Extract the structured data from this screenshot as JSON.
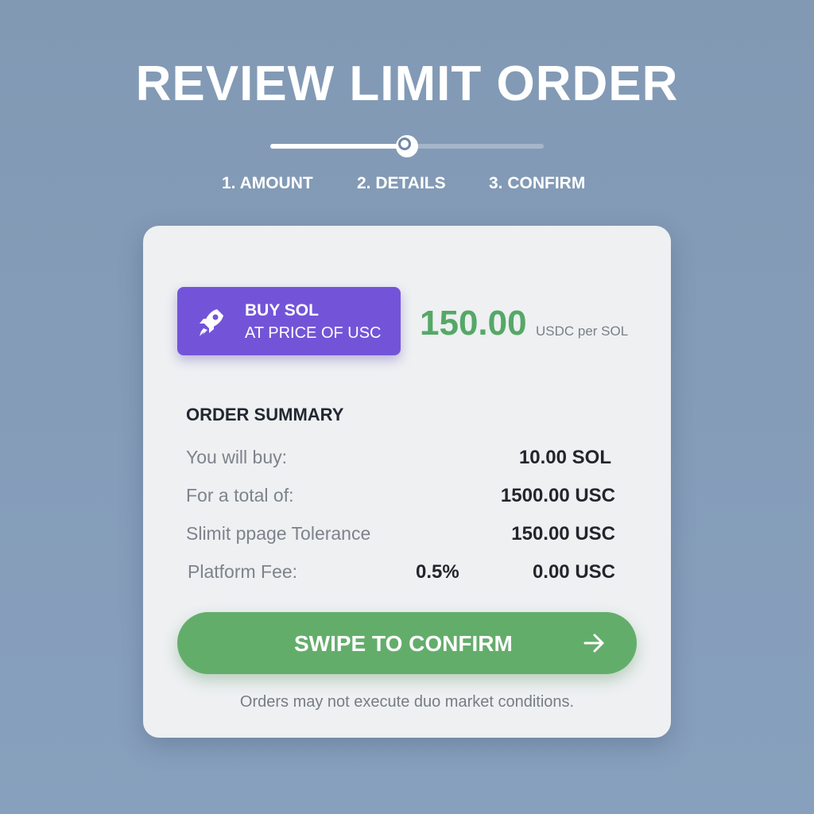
{
  "header": {
    "title": "REVIEW LIMIT ORDER",
    "progress_fraction": 0.5,
    "steps": [
      {
        "label": "1. AMOUNT"
      },
      {
        "label": "2. DETAILS"
      },
      {
        "label": "3. CONFIRM"
      }
    ]
  },
  "order": {
    "badge_line1": "BUY SOL",
    "badge_line2": "AT PRICE OF USC",
    "badge_icon": "rocket-icon",
    "price": "150.00",
    "price_unit": "USDC per SOL"
  },
  "summary": {
    "title": "ORDER SUMMARY",
    "rows": [
      {
        "label": "You will buy:",
        "value": "10.00 SOL"
      },
      {
        "label": "For a total of:",
        "value": "1500.00 USC"
      },
      {
        "label": "Slimit ppage Tolerance",
        "value": "150.00 USC"
      },
      {
        "label": "Platform Fee:",
        "extra": "0.5%",
        "value": "0.00 USC"
      }
    ]
  },
  "action": {
    "swipe_label": "SWIPE TO CONFIRM",
    "swipe_icon": "arrow-right-icon"
  },
  "footer": {
    "disclaimer": "Orders may not execute duo market conditions."
  },
  "colors": {
    "background": "#8299b4",
    "badge": "#7354d8",
    "price": "#55a866",
    "swipe": "#63ad6b"
  }
}
